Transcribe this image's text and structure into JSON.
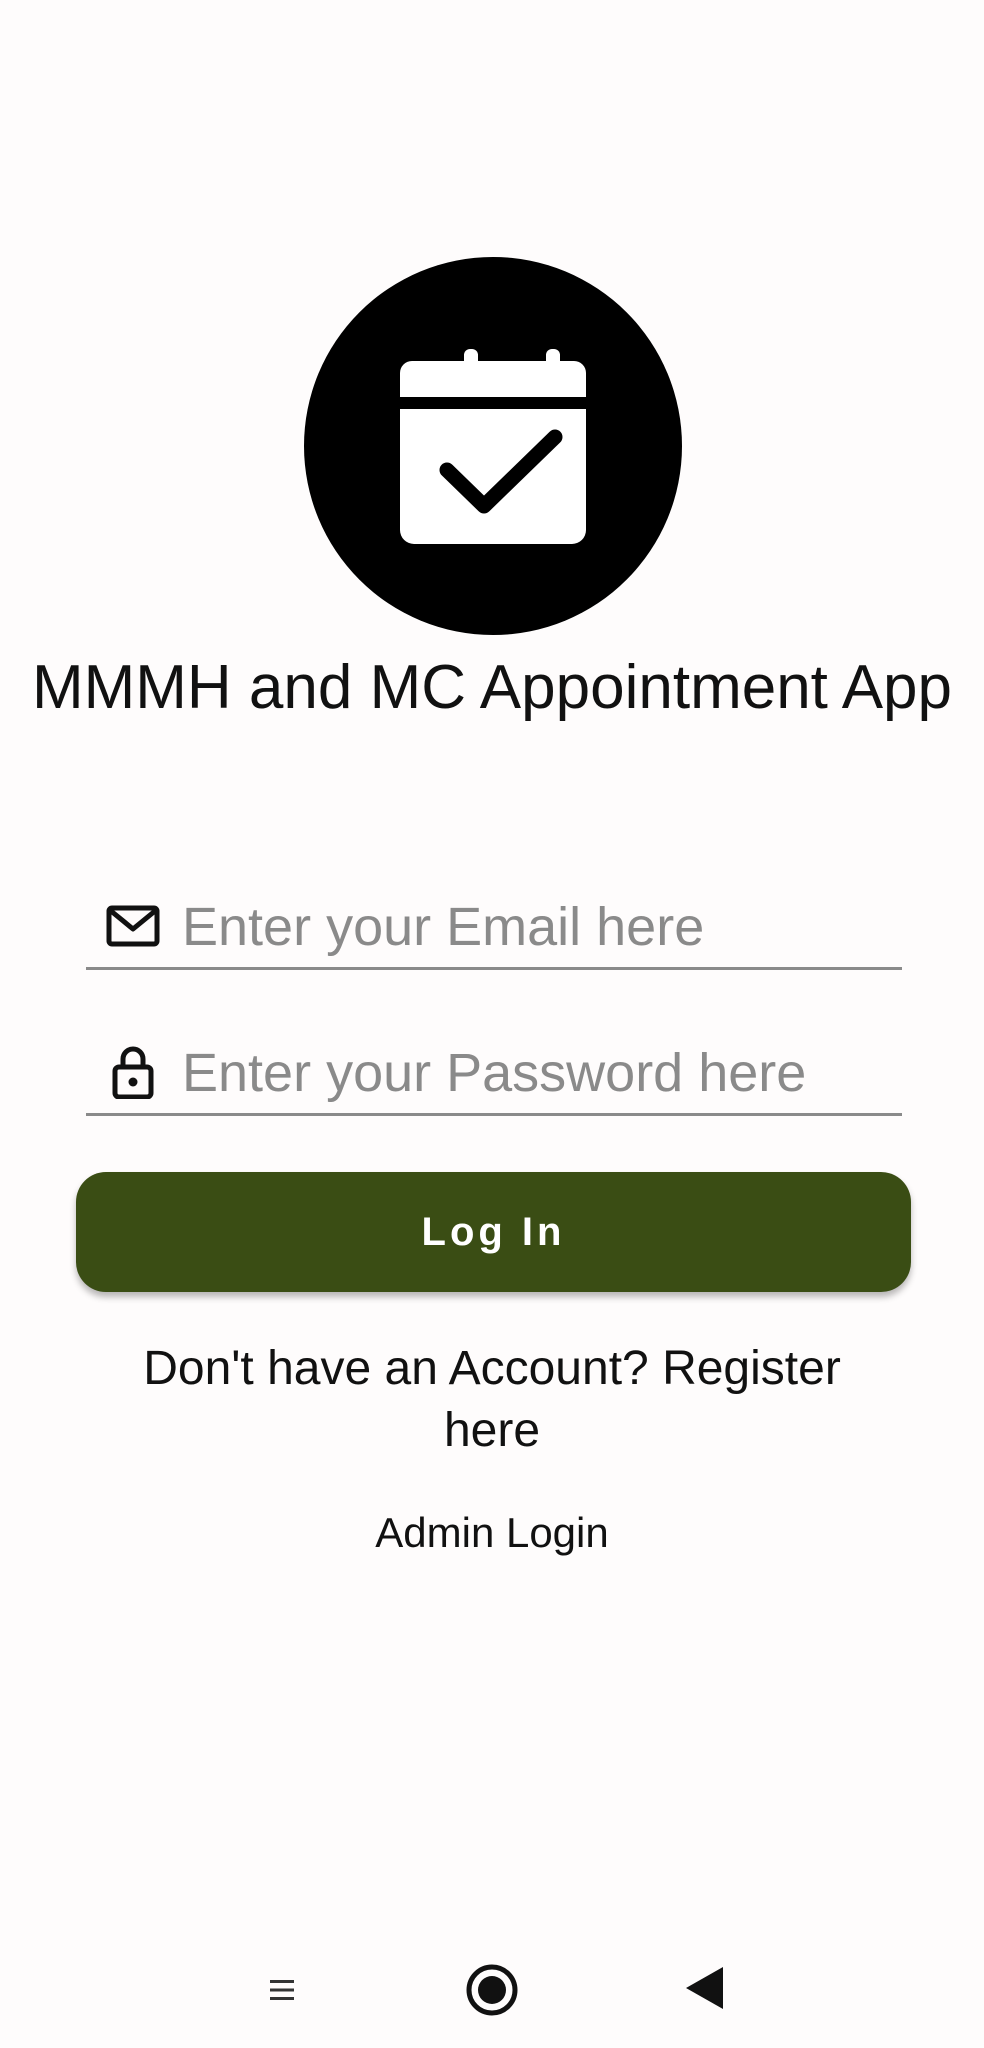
{
  "app": {
    "title": "MMMH and MC Appointment App",
    "logo_icon": "calendar-check-icon"
  },
  "form": {
    "email": {
      "placeholder": "Enter your Email here",
      "value": "",
      "icon": "mail-icon"
    },
    "password": {
      "placeholder": "Enter your Password here",
      "value": "",
      "icon": "lock-icon"
    },
    "login_label": "Log In"
  },
  "links": {
    "register": "Don't have an Account? Register here",
    "admin": "Admin Login"
  },
  "nav": {
    "items": [
      "menu-icon",
      "home-icon",
      "back-icon"
    ]
  },
  "colors": {
    "accent": "#3a4d14",
    "background": "#fefcfc",
    "text": "#111111",
    "placeholder": "#8a8a8a"
  }
}
